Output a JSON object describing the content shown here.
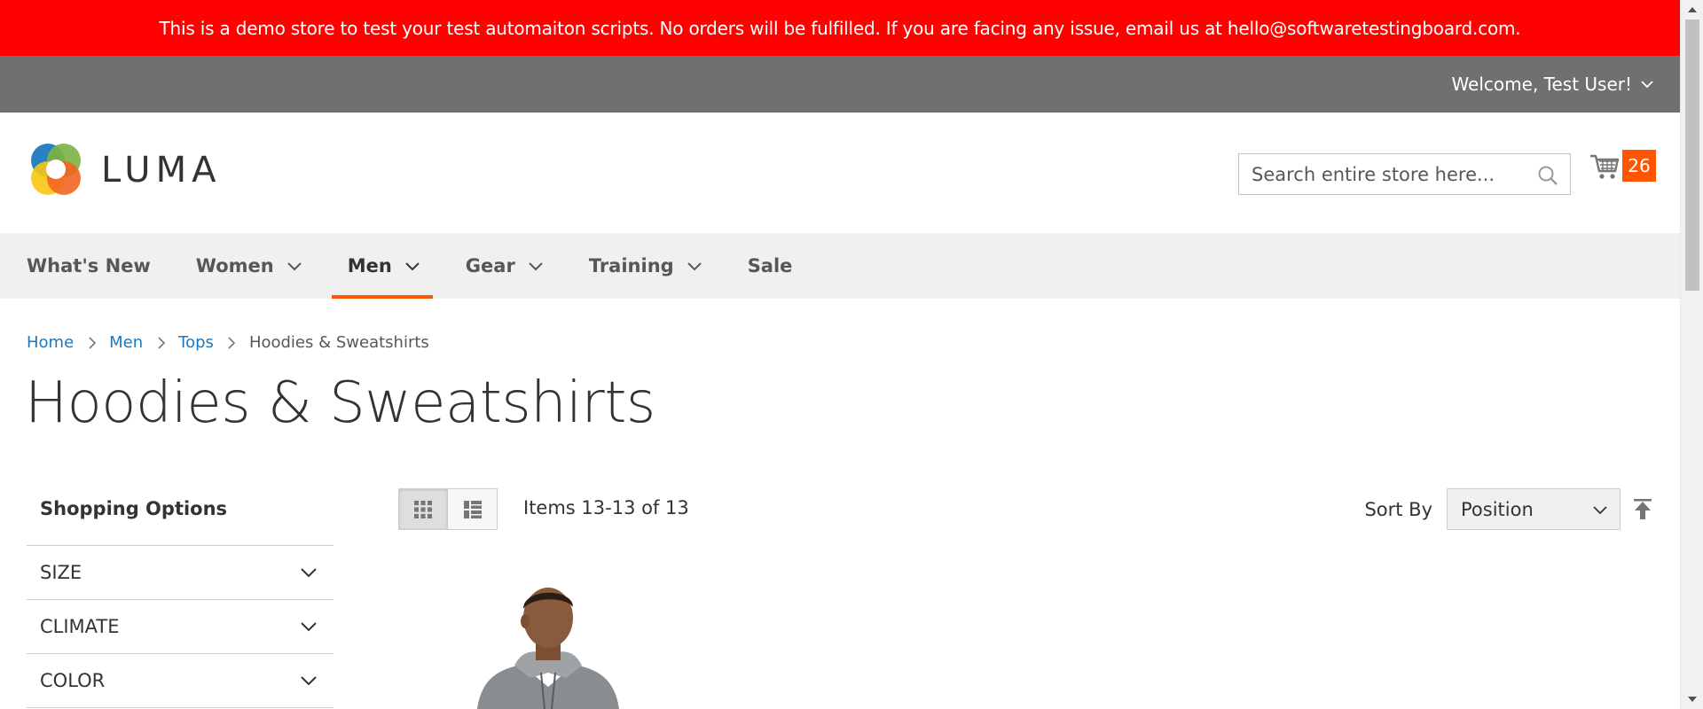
{
  "notice": {
    "text": "This is a demo store to test your test automaiton scripts. No orders will be fulfilled. If you are facing any issue, email us at hello@softwaretestingboard.com."
  },
  "header": {
    "welcome": "Welcome, Test User!"
  },
  "logo": {
    "text": "LUMA"
  },
  "search": {
    "placeholder": "Search entire store here..."
  },
  "cart": {
    "count": "26"
  },
  "nav": {
    "items": [
      {
        "label": "What's New"
      },
      {
        "label": "Women"
      },
      {
        "label": "Men"
      },
      {
        "label": "Gear"
      },
      {
        "label": "Training"
      },
      {
        "label": "Sale"
      }
    ],
    "active": "Men"
  },
  "breadcrumbs": {
    "home": "Home",
    "men": "Men",
    "tops": "Tops",
    "current": "Hoodies & Sweatshirts"
  },
  "page": {
    "title": "Hoodies & Sweatshirts"
  },
  "sidebar": {
    "title": "Shopping Options",
    "filters": [
      {
        "label": "SIZE"
      },
      {
        "label": "CLIMATE"
      },
      {
        "label": "COLOR"
      }
    ]
  },
  "toolbar": {
    "amount": "Items 13-13 of 13",
    "sort_label": "Sort By",
    "sort_value": "Position"
  },
  "colors": {
    "notice_bg": "#ff0101",
    "header_bg": "#6e716e",
    "nav_bg": "#f0f0f0",
    "accent": "#ff5501",
    "link": "#1979c3"
  },
  "icons": {
    "search": "search-icon",
    "cart": "cart-icon",
    "grid_mode": "grid-icon",
    "list_mode": "list-icon",
    "sort_direction": "arrow-up-icon"
  }
}
